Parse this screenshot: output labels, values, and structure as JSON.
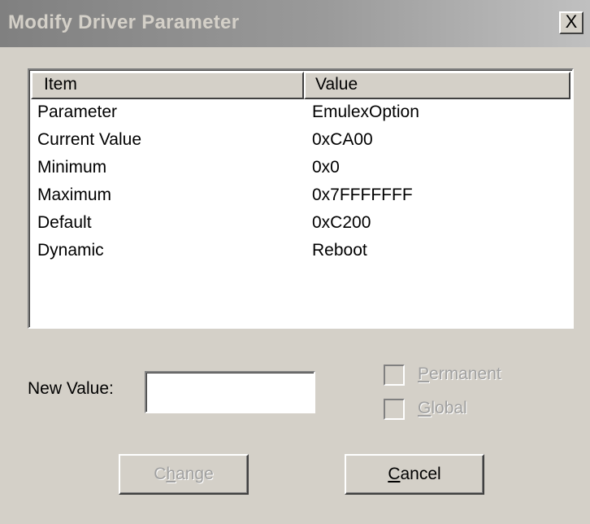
{
  "window": {
    "title": "Modify Driver Parameter",
    "close_glyph": "X"
  },
  "list": {
    "columns": [
      "Item",
      "Value"
    ],
    "rows": [
      {
        "item": "Parameter",
        "value": "EmulexOption"
      },
      {
        "item": "Current Value",
        "value": "0xCA00"
      },
      {
        "item": "Minimum",
        "value": "0x0"
      },
      {
        "item": "Maximum",
        "value": "0x7FFFFFFF"
      },
      {
        "item": "Default",
        "value": "0xC200"
      },
      {
        "item": "Dynamic",
        "value": "Reboot"
      }
    ]
  },
  "new_value": {
    "label": "New Value:",
    "value": ""
  },
  "options": {
    "permanent": {
      "prefix": "",
      "accel": "P",
      "rest": "ermanent",
      "checked": false,
      "enabled": false
    },
    "global": {
      "prefix": "",
      "accel": "G",
      "rest": "lobal",
      "checked": false,
      "enabled": false
    }
  },
  "buttons": {
    "change": {
      "prefix": "C",
      "accel": "h",
      "rest": "ange",
      "enabled": false
    },
    "cancel": {
      "prefix": "",
      "accel": "C",
      "rest": "ancel",
      "enabled": true
    }
  }
}
